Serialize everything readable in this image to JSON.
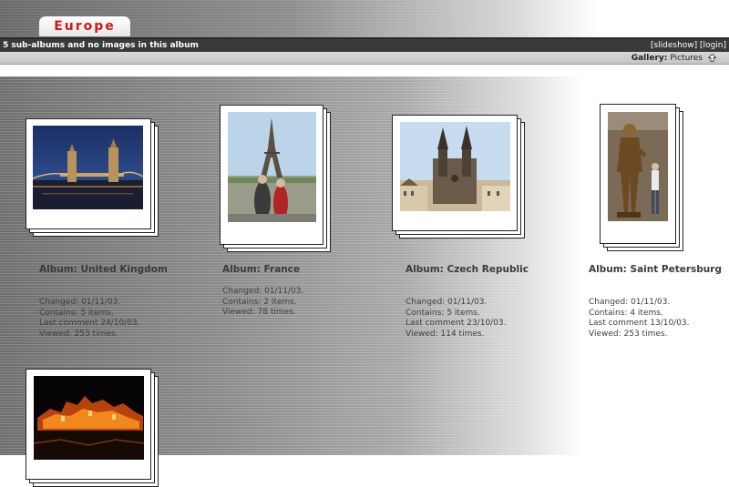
{
  "header": {
    "title": "Europe",
    "subtitle": "5 sub-albums and no images in this album",
    "slideshow_link": "[slideshow]",
    "login_link": "[login]",
    "breadcrumb_label": "Gallery:",
    "breadcrumb_link": "Pictures",
    "breadcrumb_icon": "up-arrow-icon"
  },
  "albums": [
    {
      "title": "Album: United Kingdom",
      "changed": "Changed: 01/11/03.",
      "contains": "Contains: 5 items.",
      "last_comment": "Last comment 24/10/03.",
      "viewed": "Viewed: 253 times."
    },
    {
      "title": "Album: France",
      "changed": "Changed: 01/11/03.",
      "contains": "Contains: 2 items.",
      "viewed": "Viewed: 78 times."
    },
    {
      "title": "Album: Czech Republic",
      "changed": "Changed: 01/11/03.",
      "contains": "Contains: 5 items.",
      "last_comment": "Last comment 23/10/03.",
      "viewed": "Viewed: 114 times."
    },
    {
      "title": "Album: Saint Petersburg",
      "changed": "Changed: 01/11/03.",
      "contains": "Contains: 4 items.",
      "last_comment": "Last comment 13/10/03.",
      "viewed": "Viewed: 253 times."
    },
    {
      "title": "",
      "changed": "",
      "contains": "",
      "viewed": ""
    }
  ],
  "colors": {
    "title_red": "#d01818",
    "info_bar": "#3a3a3a",
    "breadcrumb_bar": "#cfcfcf"
  }
}
